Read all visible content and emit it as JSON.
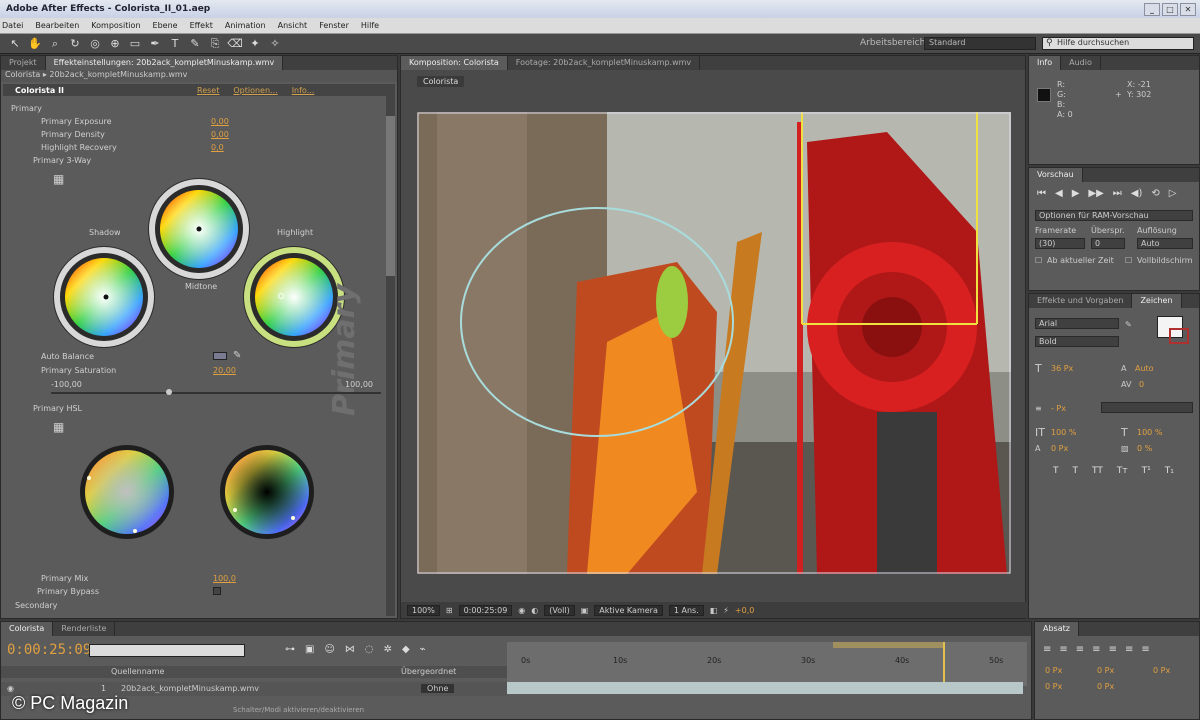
{
  "app": {
    "title": "Adobe After Effects - Colorista_II_01.aep",
    "menu": [
      "Datei",
      "Bearbeiten",
      "Komposition",
      "Ebene",
      "Effekt",
      "Animation",
      "Ansicht",
      "Fenster",
      "Hilfe"
    ]
  },
  "toolbar": {
    "workspace_label": "Arbeitsbereich:",
    "workspace_value": "Standard",
    "search_placeholder": "Hilfe durchsuchen"
  },
  "effects": {
    "tab_project": "Projekt",
    "tab_effects": "Effekteinstellungen: 20b2ack_kompletMinuskamp.wmv",
    "subtitle": "Colorista ▸ 20b2ack_kompletMinuskamp.wmv",
    "effect_name": "Colorista II",
    "links": [
      "Reset",
      "Optionen...",
      "Info..."
    ],
    "props": {
      "primary": "Primary",
      "exposure": "Primary Exposure",
      "exposure_val": "0,00",
      "density": "Primary Density",
      "density_val": "0,00",
      "recovery": "Highlight Recovery",
      "recovery_val": "0,0",
      "threeway": "Primary 3-Way",
      "shadow": "Shadow",
      "midtone": "Midtone",
      "highlight": "Highlight",
      "autobalance": "Auto Balance",
      "saturation": "Primary Saturation",
      "saturation_val": "20,00",
      "sat_min": "-100,00",
      "sat_max": "100,00",
      "hsl": "Primary HSL",
      "mix": "Primary Mix",
      "mix_val": "100,0",
      "bypass": "Primary Bypass",
      "secondary": "Secondary"
    },
    "watermark_label": "Primary"
  },
  "comp": {
    "tab_comp": "Komposition: Colorista",
    "tab_footage": "Footage: 20b2ack_kompletMinuskamp.wmv",
    "comp_name": "Colorista",
    "zoom": "100%",
    "timecode": "0:00:25:09",
    "resolution": "(Voll)",
    "camera": "Aktive Kamera",
    "views": "1 Ans.",
    "offset": "+0,0"
  },
  "info": {
    "tab_info": "Info",
    "tab_audio": "Audio",
    "r": "R:",
    "g": "G:",
    "b": "B:",
    "a": "A: 0",
    "x": "X: -21",
    "y": "Y: 302"
  },
  "preview": {
    "tab": "Vorschau",
    "dropdown": "Optionen für RAM-Vorschau",
    "framerate_label": "Framerate",
    "skip_label": "Überspr.",
    "res_label": "Auflösung",
    "framerate": "(30)",
    "skip": "0",
    "res": "Auto",
    "from_current": "Ab aktueller Zeit",
    "fullscreen": "Vollbildschirm"
  },
  "chars": {
    "tab_effects": "Effekte und Vorgaben",
    "tab_chars": "Zeichen",
    "font": "Arial",
    "style": "Bold",
    "size": "36 Px",
    "leading": "Auto",
    "tracking": "0",
    "stroke": "- Px",
    "vscale": "100 %",
    "hscale": "100 %",
    "baseline": "0 Px",
    "tsume": "0 %"
  },
  "timeline": {
    "tab": "Colorista",
    "tab_render": "Renderliste",
    "timecode": "0:00:25:09",
    "ticks": [
      "0s",
      "10s",
      "20s",
      "30s",
      "40s",
      "50s"
    ],
    "col_source": "Quellenname",
    "col_parent": "Übergeordnet",
    "layer_name": "20b2ack_kompletMinuskamp.wmv",
    "layer_num": "1",
    "parent": "Ohne",
    "switch_label": "Schalter/Modi aktivieren/deaktivieren"
  },
  "absatz": {
    "tab": "Absatz",
    "indent1": "0 Px",
    "indent2": "0 Px",
    "indent3": "0 Px",
    "space1": "0 Px",
    "space2": "0 Px"
  },
  "watermark": "© PC Magazin"
}
